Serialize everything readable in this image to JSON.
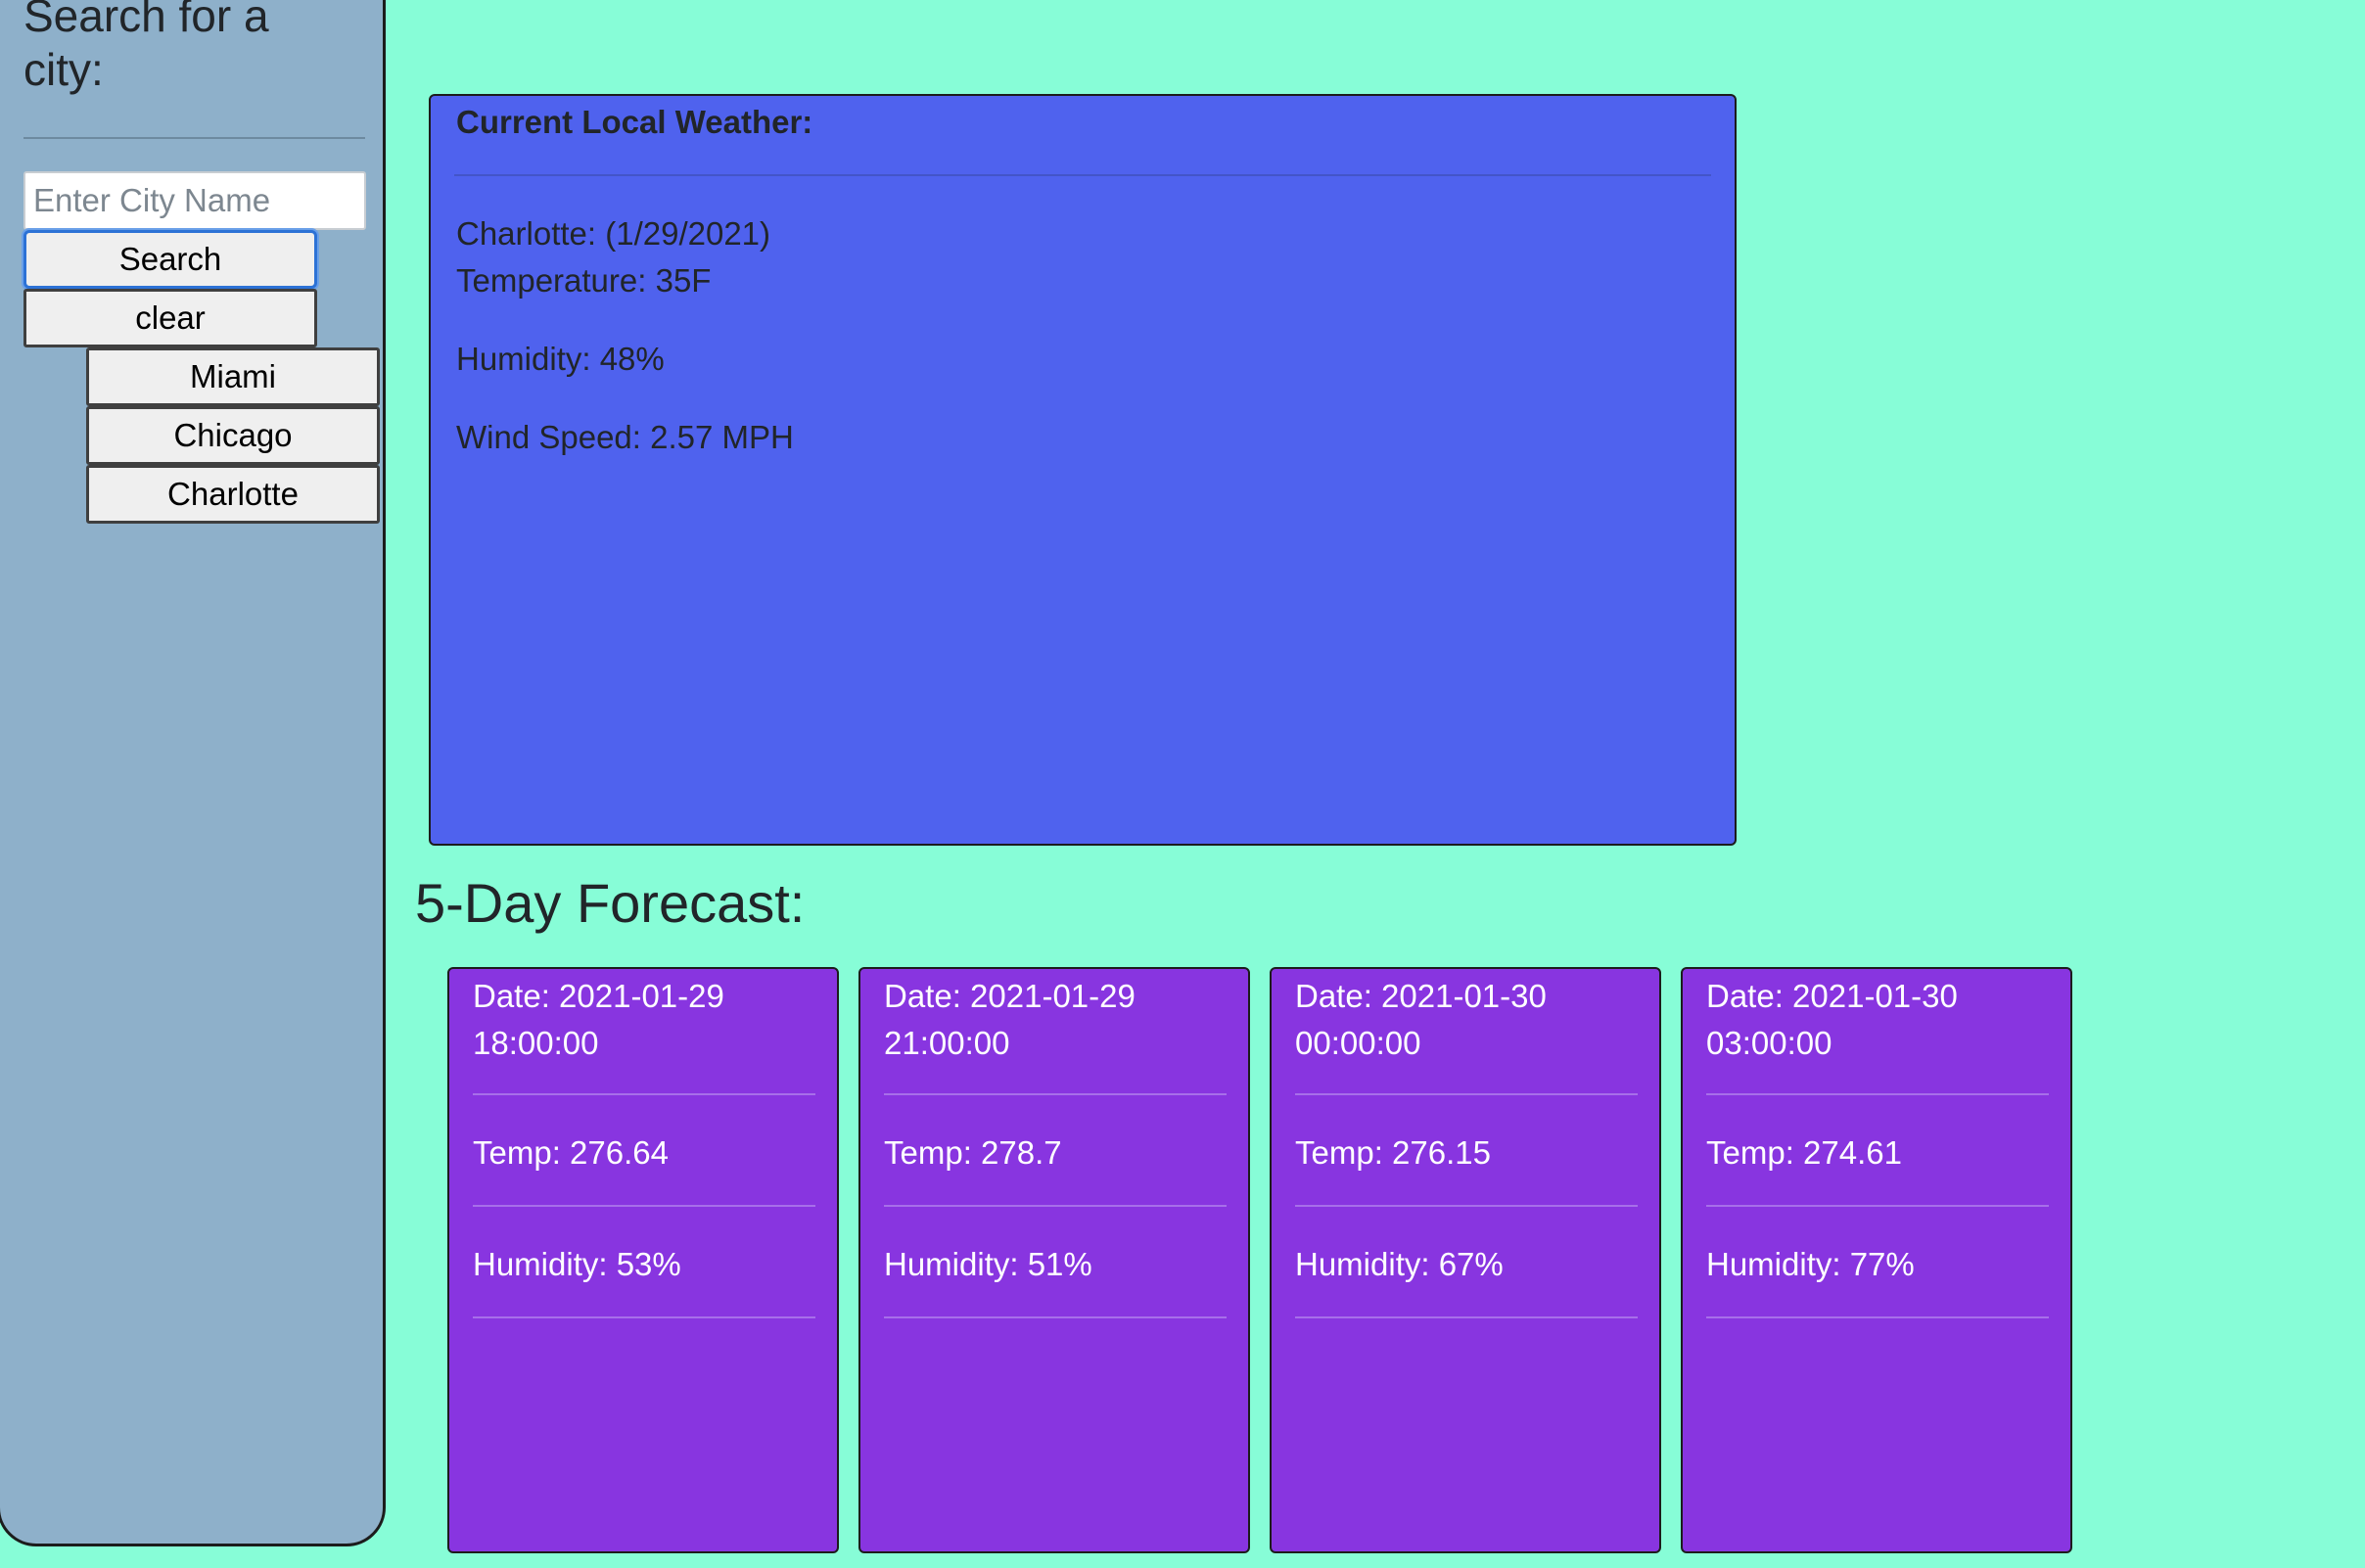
{
  "sidebar": {
    "title": "Search for a city:",
    "input_placeholder": "Enter City Name",
    "search_label": "Search",
    "clear_label": "clear",
    "history": [
      "Miami",
      "Chicago",
      "Charlotte"
    ]
  },
  "current": {
    "title": "Current Local Weather:",
    "city_date": "Charlotte: (1/29/2021)",
    "temperature": "Temperature: 35F",
    "humidity": "Humidity: 48%",
    "wind": "Wind Speed: 2.57 MPH"
  },
  "forecast": {
    "heading": "5-Day Forecast:",
    "cards": [
      {
        "date": "Date: 2021-01-29 18:00:00",
        "temp": "Temp: 276.64",
        "humidity": "Humidity: 53%"
      },
      {
        "date": "Date: 2021-01-29 21:00:00",
        "temp": "Temp: 278.7",
        "humidity": "Humidity: 51%"
      },
      {
        "date": "Date: 2021-01-30 00:00:00",
        "temp": "Temp: 276.15",
        "humidity": "Humidity: 67%"
      },
      {
        "date": "Date: 2021-01-30 03:00:00",
        "temp": "Temp: 274.61",
        "humidity": "Humidity: 77%"
      }
    ]
  },
  "colors": {
    "page_background": "#87fdd7",
    "sidebar_background": "#8eb0ca",
    "current_background": "#4f62ee",
    "forecast_card_background": "#8835e0"
  }
}
